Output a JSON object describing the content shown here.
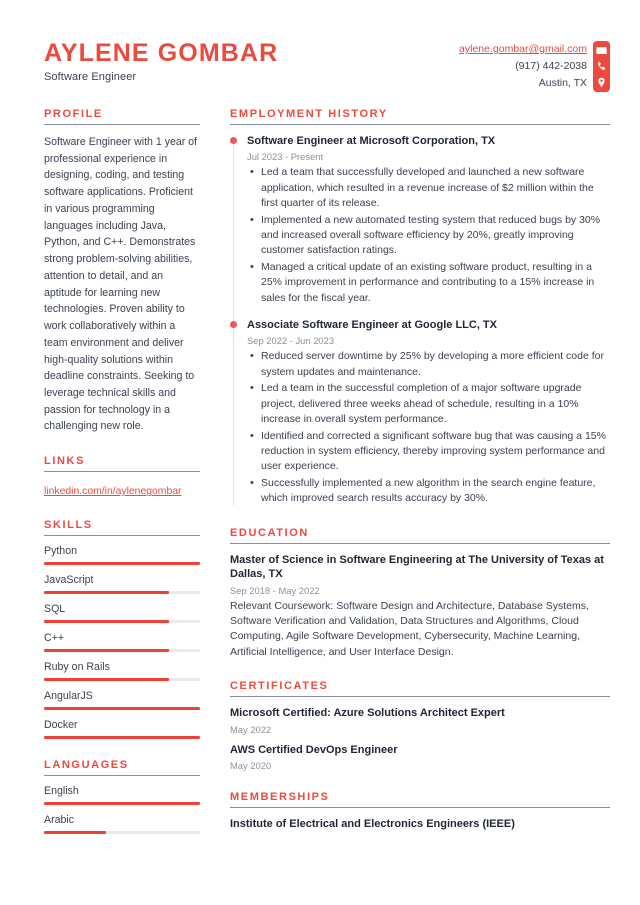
{
  "header": {
    "full_name": "AYLENE GOMBAR",
    "job_title": "Software Engineer",
    "contact": {
      "email": "aylene.gombar@gmail.com",
      "phone": "(917) 442-2038",
      "location": "Austin, TX"
    },
    "icons": [
      "envelope-icon",
      "phone-icon",
      "location-pin-icon"
    ],
    "accent_color": "#eb4a3f"
  },
  "sidebar": {
    "profile": {
      "heading": "PROFILE",
      "text": "Software Engineer with 1 year of professional experience in designing, coding, and testing software applications. Proficient in various programming languages including Java, Python, and C++. Demonstrates strong problem-solving abilities, attention to detail, and an aptitude for learning new technologies. Proven ability to work collaboratively within a team environment and deliver high-quality solutions within deadline constraints. Seeking to leverage technical skills and passion for technology in a challenging new role."
    },
    "links": {
      "heading": "LINKS",
      "items": [
        {
          "label": "linkedin.com/in/aylenegombar"
        }
      ]
    },
    "skills": {
      "heading": "SKILLS",
      "items": [
        {
          "name": "Python",
          "level": 100
        },
        {
          "name": "JavaScript",
          "level": 80
        },
        {
          "name": "SQL",
          "level": 80
        },
        {
          "name": "C++",
          "level": 80
        },
        {
          "name": "Ruby on Rails",
          "level": 80
        },
        {
          "name": "AngularJS",
          "level": 100
        },
        {
          "name": "Docker",
          "level": 100
        }
      ]
    },
    "languages": {
      "heading": "LANGUAGES",
      "items": [
        {
          "name": "English",
          "level": 100
        },
        {
          "name": "Arabic",
          "level": 40
        }
      ]
    }
  },
  "main": {
    "employment": {
      "heading": "EMPLOYMENT HISTORY",
      "jobs": [
        {
          "title": "Software Engineer at Microsoft Corporation, TX",
          "dates": "Jul 2023 - Present",
          "bullets": [
            "Led a team that successfully developed and launched a new software application, which resulted in a revenue increase of $2 million within the first quarter of its release.",
            "Implemented a new automated testing system that reduced bugs by 30% and increased overall software efficiency by 20%, greatly improving customer satisfaction ratings.",
            "Managed a critical update of an existing software product, resulting in a 25% improvement in performance and contributing to a 15% increase in sales for the fiscal year."
          ]
        },
        {
          "title": "Associate Software Engineer at Google LLC, TX",
          "dates": "Sep 2022 - Jun 2023",
          "bullets": [
            "Reduced server downtime by 25% by developing a more efficient code for system updates and maintenance.",
            "Led a team in the successful completion of a major software upgrade project, delivered three weeks ahead of schedule, resulting in a 10% increase in overall system performance.",
            "Identified and corrected a significant software bug that was causing a 15% reduction in system efficiency, thereby improving system performance and user experience.",
            "Successfully implemented a new algorithm in the search engine feature, which improved search results accuracy by 30%."
          ]
        }
      ]
    },
    "education": {
      "heading": "EDUCATION",
      "entries": [
        {
          "title": "Master of Science in Software Engineering at The University of Texas at Dallas, TX",
          "dates": "Sep 2018 - May 2022",
          "description": "Relevant Coursework: Software Design and Architecture, Database Systems, Software Verification and Validation, Data Structures and Algorithms, Cloud Computing, Agile Software Development, Cybersecurity, Machine Learning, Artificial Intelligence, and User Interface Design."
        }
      ]
    },
    "certificates": {
      "heading": "CERTIFICATES",
      "entries": [
        {
          "title": "Microsoft Certified: Azure Solutions Architect Expert",
          "dates": "May 2022"
        },
        {
          "title": "AWS Certified DevOps Engineer",
          "dates": "May 2020"
        }
      ]
    },
    "memberships": {
      "heading": "MEMBERSHIPS",
      "entries": [
        {
          "title": "Institute of Electrical and Electronics Engineers (IEEE)"
        }
      ]
    }
  }
}
